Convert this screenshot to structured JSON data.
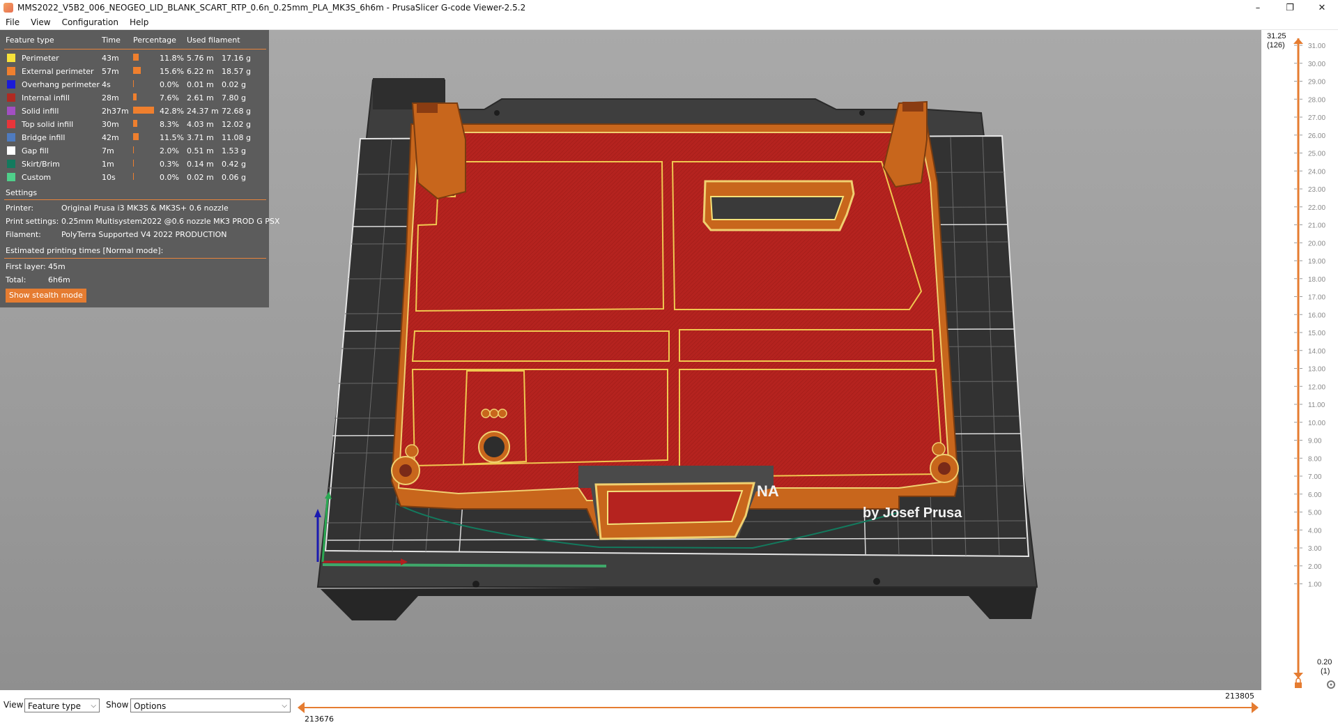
{
  "window": {
    "title": "MMS2022_V5B2_006_NEOGEO_LID_BLANK_SCART_RTP_0.6n_0.25mm_PLA_MK3S_6h6m - PrusaSlicer G-code Viewer-2.5.2",
    "minimize": "–",
    "maximize": "❐",
    "close": "✕"
  },
  "menu": {
    "file": "File",
    "view": "View",
    "configuration": "Configuration",
    "help": "Help"
  },
  "legend": {
    "headers": {
      "feature": "Feature type",
      "time": "Time",
      "percentage": "Percentage",
      "used": "Used filament"
    },
    "rows": [
      {
        "name": "Perimeter",
        "time": "43m",
        "pct": "11.8%",
        "len": "5.76 m",
        "weight": "17.16 g",
        "color": "#f6e23a",
        "share": 0.118
      },
      {
        "name": "External perimeter",
        "time": "57m",
        "pct": "15.6%",
        "len": "6.22 m",
        "weight": "18.57 g",
        "color": "#ef7f2e",
        "share": 0.156
      },
      {
        "name": "Overhang perimeter",
        "time": "4s",
        "pct": "0.0%",
        "len": "0.01 m",
        "weight": "0.02 g",
        "color": "#1b1bd8",
        "share": 0.0
      },
      {
        "name": "Internal infill",
        "time": "28m",
        "pct": "7.6%",
        "len": "2.61 m",
        "weight": "7.80 g",
        "color": "#b02a22",
        "share": 0.076
      },
      {
        "name": "Solid infill",
        "time": "2h37m",
        "pct": "42.8%",
        "len": "24.37 m",
        "weight": "72.68 g",
        "color": "#a24fc2",
        "share": 0.428
      },
      {
        "name": "Top solid infill",
        "time": "30m",
        "pct": "8.3%",
        "len": "4.03 m",
        "weight": "12.02 g",
        "color": "#e8353a",
        "share": 0.083
      },
      {
        "name": "Bridge infill",
        "time": "42m",
        "pct": "11.5%",
        "len": "3.71 m",
        "weight": "11.08 g",
        "color": "#4f7bbf",
        "share": 0.115
      },
      {
        "name": "Gap fill",
        "time": "7m",
        "pct": "2.0%",
        "len": "0.51 m",
        "weight": "1.53 g",
        "color": "#ffffff",
        "share": 0.02
      },
      {
        "name": "Skirt/Brim",
        "time": "1m",
        "pct": "0.3%",
        "len": "0.14 m",
        "weight": "0.42 g",
        "color": "#137a5e",
        "share": 0.003
      },
      {
        "name": "Custom",
        "time": "10s",
        "pct": "0.0%",
        "len": "0.02 m",
        "weight": "0.06 g",
        "color": "#4fcf8a",
        "share": 0.0
      }
    ],
    "settings_heading": "Settings",
    "printer_label": "Printer:",
    "printer_value": "Original Prusa i3 MK3S & MK3S+ 0.6 nozzle",
    "print_settings_label": "Print settings:",
    "print_settings_value": "0.25mm Multisystem2022 @0.6 nozzle MK3 PROD G PSX",
    "filament_label": "Filament:",
    "filament_value": "PolyTerra Supported V4 2022 PRODUCTION",
    "est_heading": "Estimated printing times [Normal mode]:",
    "first_layer_label": "First layer:",
    "first_layer_value": "45m",
    "total_label": "Total:",
    "total_value": "6h6m",
    "stealth_button": "Show stealth mode"
  },
  "bed": {
    "brand_text": "by Josef Prusa",
    "brand_partial": "NA"
  },
  "bottom": {
    "view_label": "View",
    "view_value": "Feature type",
    "show_label": "Show",
    "show_value": "Options",
    "h_left_value": "213676",
    "h_right_value": "213805"
  },
  "vslider": {
    "top_value": "31.25",
    "top_layer": "(126)",
    "bottom_value": "0.20",
    "bottom_layer": "(1)",
    "ticks": [
      "31.00",
      "30.00",
      "29.00",
      "28.00",
      "27.00",
      "26.00",
      "25.00",
      "24.00",
      "23.00",
      "22.00",
      "21.00",
      "20.00",
      "19.00",
      "18.00",
      "17.00",
      "16.00",
      "15.00",
      "14.00",
      "13.00",
      "12.00",
      "11.00",
      "10.00",
      "9.00",
      "8.00",
      "7.00",
      "6.00",
      "5.00",
      "4.00",
      "3.00",
      "2.00",
      "1.00"
    ]
  },
  "colors": {
    "accent": "#e57c31",
    "panel": "#5a5a5a",
    "part": "#b7231f",
    "perimeter": "#c8661c"
  }
}
